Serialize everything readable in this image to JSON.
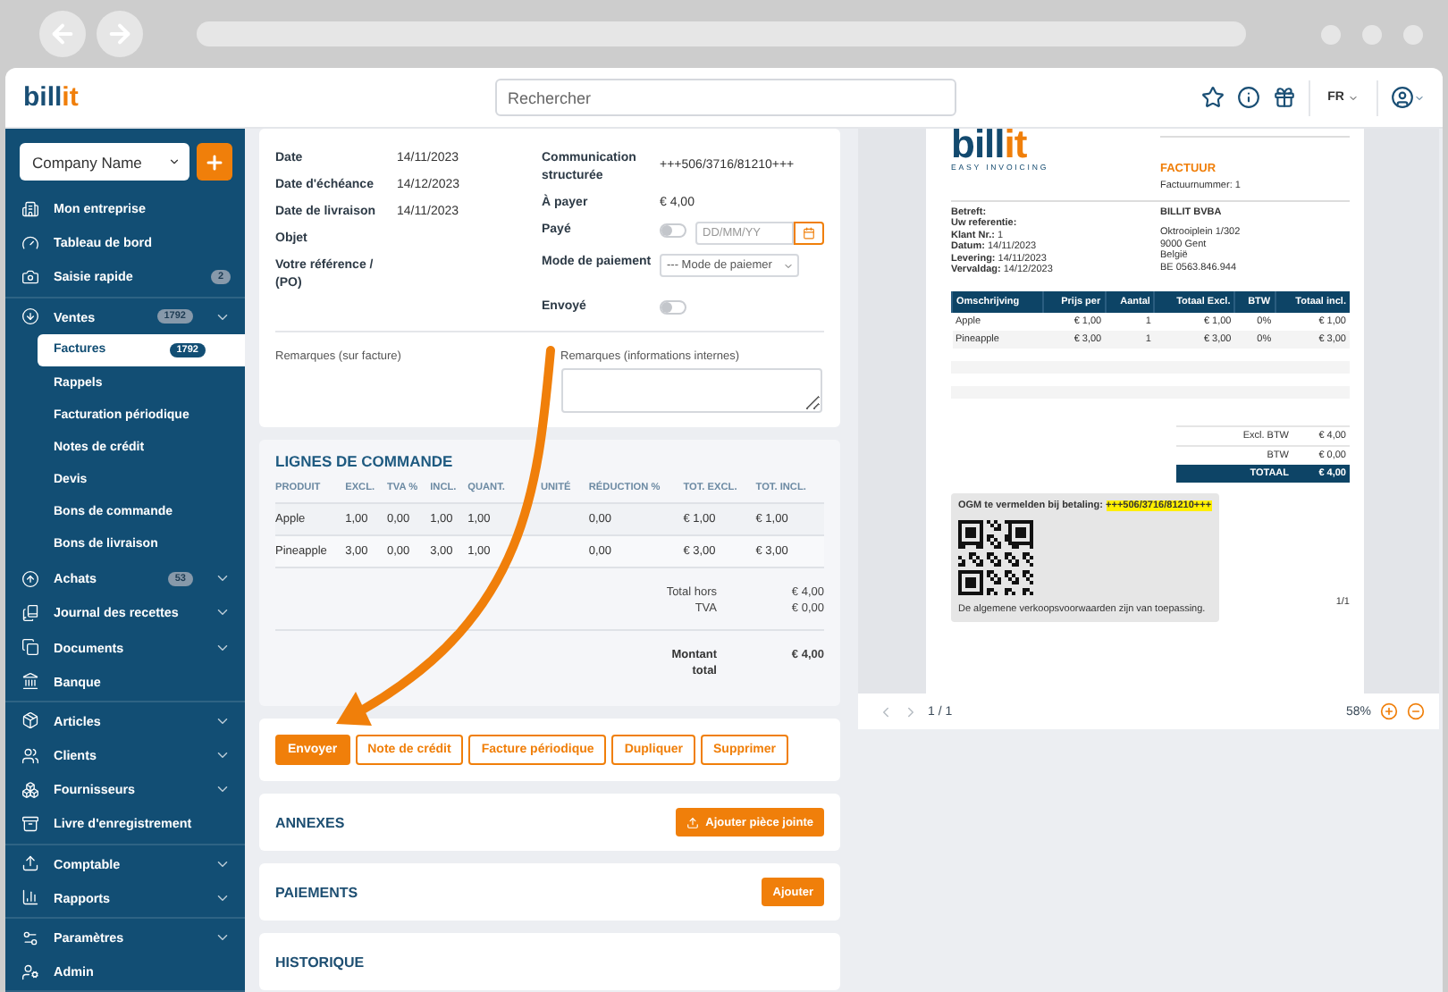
{
  "header": {
    "logo": {
      "prefix": "bill",
      "suffix": "it"
    },
    "search": {
      "placeholder": "Rechercher"
    },
    "language": "FR"
  },
  "sidebar": {
    "company": "Company Name",
    "sections": [
      [
        {
          "label": "Mon entreprise",
          "submenu": false
        },
        {
          "label": "Tableau de bord",
          "submenu": false
        },
        {
          "label": "Saisie rapide",
          "badge": "2",
          "submenu": false
        }
      ],
      [
        {
          "label": "Ventes",
          "badge": "1792",
          "submenu": true,
          "children": [
            {
              "label": "Factures",
              "badge": "1792",
              "selected": true
            },
            {
              "label": "Rappels",
              "selected": false
            },
            {
              "label": "Facturation périodique",
              "selected": false
            },
            {
              "label": "Notes de crédit",
              "selected": false
            },
            {
              "label": "Devis",
              "selected": false
            },
            {
              "label": "Bons de commande",
              "selected": false
            },
            {
              "label": "Bons de livraison",
              "selected": false
            }
          ]
        },
        {
          "label": "Achats",
          "badge": "53",
          "submenu": true
        },
        {
          "label": "Journal des recettes",
          "submenu": true
        },
        {
          "label": "Documents",
          "submenu": true
        },
        {
          "label": "Banque",
          "submenu": false
        }
      ],
      [
        {
          "label": "Articles",
          "submenu": true
        },
        {
          "label": "Clients",
          "submenu": true
        },
        {
          "label": "Fournisseurs",
          "submenu": true
        },
        {
          "label": "Livre d'enregistrement",
          "submenu": false
        }
      ],
      [
        {
          "label": "Comptable",
          "submenu": true
        },
        {
          "label": "Rapports",
          "submenu": true
        }
      ],
      [
        {
          "label": "Paramètres",
          "submenu": true
        },
        {
          "label": "Admin",
          "submenu": false
        }
      ]
    ]
  },
  "invoice": {
    "left": [
      {
        "label": "Date",
        "value": "14/11/2023"
      },
      {
        "label": "Date d'échéance",
        "value": "14/12/2023"
      },
      {
        "label": "Date de livraison",
        "value": "14/11/2023"
      },
      {
        "label": "Objet"
      },
      {
        "label": "Votre référence / (PO)"
      }
    ],
    "right": [
      {
        "label": "Communication structurée",
        "kind": "text",
        "value": "+++506/3716/81210+++"
      },
      {
        "label": "À payer",
        "kind": "text",
        "value": "€ 4,00"
      },
      {
        "label": "Payé",
        "kind": "toggle_date",
        "on": false,
        "placeholder": "DD/MM/YY"
      },
      {
        "label": "Mode de paiement",
        "kind": "select",
        "value": "--- Mode de paiemer"
      },
      {
        "label": "Envoyé",
        "kind": "toggle",
        "on": false
      }
    ]
  },
  "remarks": {
    "invoice_label": "Remarques (sur facture)",
    "internal_label": "Remarques (informations internes)"
  },
  "order_lines": {
    "title": "LIGNES DE COMMANDE",
    "columns": [
      "PRODUIT",
      "EXCL.",
      "TVA %",
      "INCL.",
      "QUANT.",
      "UNITÉ",
      "RÉDUCTION %",
      "TOT. EXCL.",
      "TOT. INCL."
    ],
    "rows": [
      [
        "Apple",
        "1,00",
        "0,00",
        "1,00",
        "1,00",
        "",
        "0,00",
        "€ 1,00",
        "€ 1,00"
      ],
      [
        "Pineapple",
        "3,00",
        "0,00",
        "3,00",
        "1,00",
        "",
        "0,00",
        "€ 3,00",
        "€ 3,00"
      ]
    ],
    "totals": [
      {
        "label": "Total hors",
        "value": "€ 4,00"
      },
      {
        "label": "TVA",
        "value": "€ 0,00"
      }
    ],
    "grand_total": {
      "label": "Montant total",
      "value": "€ 4,00"
    }
  },
  "actions": [
    {
      "label": "Envoyer",
      "kind": "primary"
    },
    {
      "label": "Note de crédit",
      "kind": "outline"
    },
    {
      "label": "Facture périodique",
      "kind": "outline"
    },
    {
      "label": "Dupliquer",
      "kind": "outline"
    },
    {
      "label": "Supprimer",
      "kind": "outline"
    }
  ],
  "sections": [
    {
      "title": "ANNEXES",
      "button": "Ajouter pièce jointe",
      "kind": "upload"
    },
    {
      "title": "PAIEMENTS",
      "button": "Ajouter",
      "kind": "plain"
    },
    {
      "title": "HISTORIQUE",
      "kind": "none"
    }
  ],
  "preview": {
    "page": "1 / 1",
    "zoom": "58%",
    "document": {
      "logo_prefix": "bill",
      "logo_suffix": "it",
      "tagline": "EASY INVOICING",
      "title": "FACTUUR",
      "number": "Factuurnummer: 1",
      "info": [
        "**Betreft:**",
        "**Uw referentie:**",
        "**Klant Nr.:** 1",
        "**Datum:** 14/11/2023",
        "**Levering:** 14/11/2023",
        "**Vervaldag:** 14/12/2023"
      ],
      "company": "BILLIT BVBA",
      "address": [
        "Oktrooiplein 1/302",
        "9000 Gent",
        "België",
        "BE 0563.846.944"
      ],
      "columns": [
        "Omschrijving",
        "Prijs per",
        "Aantal",
        "Totaal Excl.",
        "BTW",
        "Totaal incl."
      ],
      "rows": [
        [
          "Apple",
          "€ 1,00",
          "1",
          "€ 1,00",
          "0%",
          "€ 1,00"
        ],
        [
          "Pineapple",
          "€ 3,00",
          "1",
          "€ 3,00",
          "0%",
          "€ 3,00"
        ]
      ],
      "totals": [
        {
          "label": "Excl. BTW",
          "value": "€ 4,00"
        },
        {
          "label": "BTW",
          "value": "€ 0,00"
        }
      ],
      "grand_total": {
        "label": "TOTAAL",
        "value": "€ 4,00"
      },
      "payment_note": "OGM te vermelden bij betaling:",
      "payment_ref": "+++506/3716/81210+++",
      "terms": "De algemene verkoopsvoorwaarden zijn van toepassing.",
      "page_number": "1/1"
    }
  }
}
